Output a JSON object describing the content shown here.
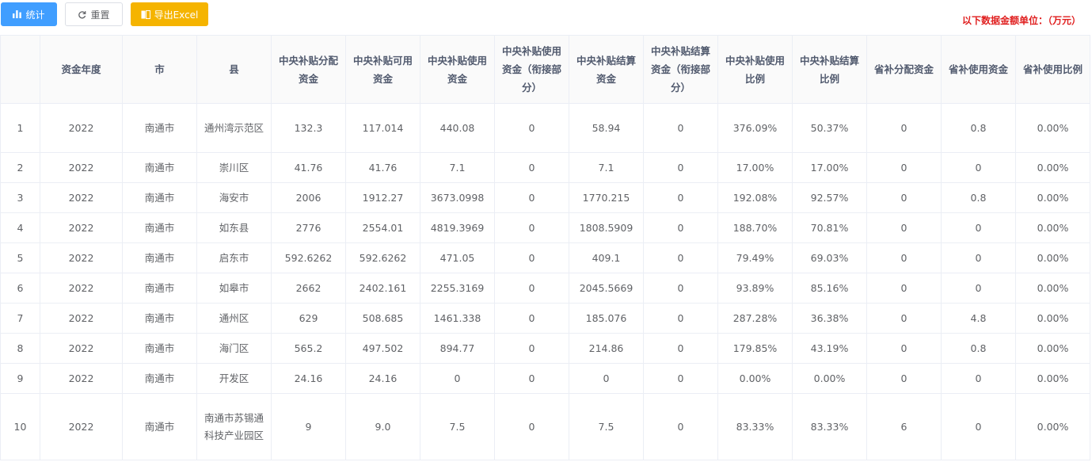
{
  "toolbar": {
    "stat_label": "统计",
    "reset_label": "重置",
    "export_label": "导出Excel"
  },
  "unit_note": "以下数据金额单位：（万元）",
  "table": {
    "headers": [
      "",
      "资金年度",
      "市",
      "县",
      "中央补贴分配资金",
      "中央补贴可用资金",
      "中央补贴使用资金",
      "中央补贴使用资金（衔接部分）",
      "中央补贴结算资金",
      "中央补贴结算资金（衔接部分）",
      "中央补贴使用比例",
      "中央补贴结算比例",
      "省补分配资金",
      "省补使用资金",
      "省补使用比例"
    ],
    "rows": [
      [
        "1",
        "2022",
        "南通市",
        "通州湾示范区",
        "132.3",
        "117.014",
        "440.08",
        "0",
        "58.94",
        "0",
        "376.09%",
        "50.37%",
        "0",
        "0.8",
        "0.00%"
      ],
      [
        "2",
        "2022",
        "南通市",
        "崇川区",
        "41.76",
        "41.76",
        "7.1",
        "0",
        "7.1",
        "0",
        "17.00%",
        "17.00%",
        "0",
        "0",
        "0.00%"
      ],
      [
        "3",
        "2022",
        "南通市",
        "海安市",
        "2006",
        "1912.27",
        "3673.0998",
        "0",
        "1770.215",
        "0",
        "192.08%",
        "92.57%",
        "0",
        "0.8",
        "0.00%"
      ],
      [
        "4",
        "2022",
        "南通市",
        "如东县",
        "2776",
        "2554.01",
        "4819.3969",
        "0",
        "1808.5909",
        "0",
        "188.70%",
        "70.81%",
        "0",
        "0",
        "0.00%"
      ],
      [
        "5",
        "2022",
        "南通市",
        "启东市",
        "592.6262",
        "592.6262",
        "471.05",
        "0",
        "409.1",
        "0",
        "79.49%",
        "69.03%",
        "0",
        "0",
        "0.00%"
      ],
      [
        "6",
        "2022",
        "南通市",
        "如皋市",
        "2662",
        "2402.161",
        "2255.3169",
        "0",
        "2045.5669",
        "0",
        "93.89%",
        "85.16%",
        "0",
        "0",
        "0.00%"
      ],
      [
        "7",
        "2022",
        "南通市",
        "通州区",
        "629",
        "508.685",
        "1461.338",
        "0",
        "185.076",
        "0",
        "287.28%",
        "36.38%",
        "0",
        "4.8",
        "0.00%"
      ],
      [
        "8",
        "2022",
        "南通市",
        "海门区",
        "565.2",
        "497.502",
        "894.77",
        "0",
        "214.86",
        "0",
        "179.85%",
        "43.19%",
        "0",
        "0.8",
        "0.00%"
      ],
      [
        "9",
        "2022",
        "南通市",
        "开发区",
        "24.16",
        "24.16",
        "0",
        "0",
        "0",
        "0",
        "0.00%",
        "0.00%",
        "0",
        "0",
        "0.00%"
      ],
      [
        "10",
        "2022",
        "南通市",
        "南通市苏锡通科技产业园区",
        "9",
        "9.0",
        "7.5",
        "0",
        "7.5",
        "0",
        "83.33%",
        "83.33%",
        "6",
        "0",
        "0.00%"
      ]
    ]
  },
  "colors": {
    "primary": "#409eff",
    "warning": "#f5b400",
    "note_red": "#e02020"
  },
  "icons": {
    "stat": "bar-chart-icon",
    "reset": "refresh-icon",
    "export": "book-icon"
  }
}
